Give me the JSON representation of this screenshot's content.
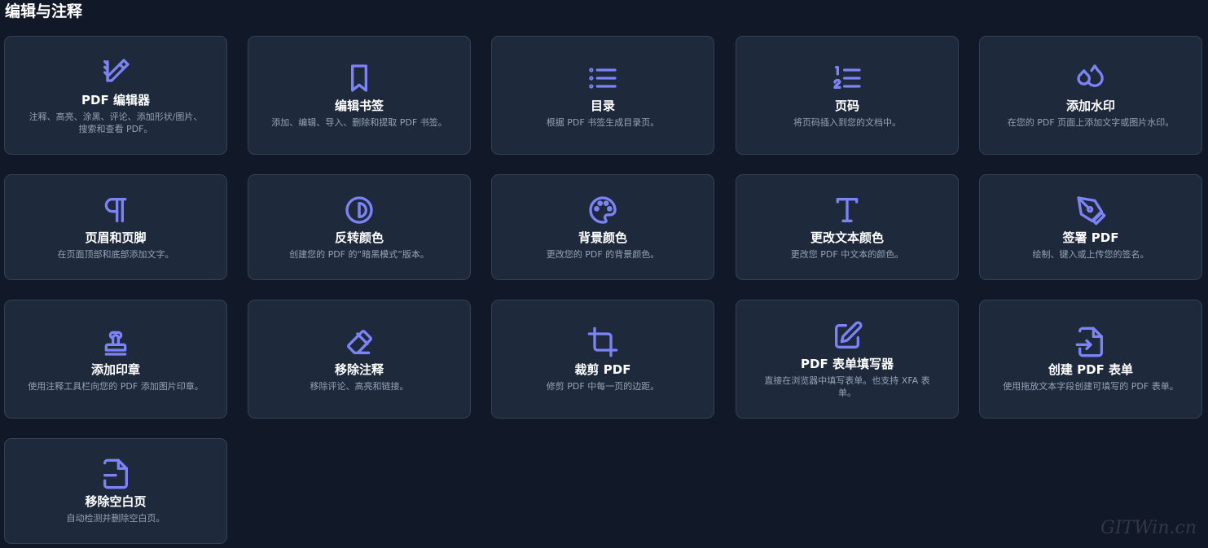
{
  "section": {
    "title": "编辑与注释"
  },
  "cards": [
    {
      "title": "PDF 编辑器",
      "desc": "注释、高亮、涂黑、评论、添加形状/图片、搜索和查看 PDF。",
      "icon": "pen-ruler-icon"
    },
    {
      "title": "编辑书签",
      "desc": "添加、编辑、导入、删除和提取 PDF 书签。",
      "icon": "bookmark-icon"
    },
    {
      "title": "目录",
      "desc": "根据 PDF 书签生成目录页。",
      "icon": "list-icon"
    },
    {
      "title": "页码",
      "desc": "将页码插入到您的文档中。",
      "icon": "numbered-list-icon"
    },
    {
      "title": "添加水印",
      "desc": "在您的 PDF 页面上添加文字或图片水印。",
      "icon": "droplets-icon"
    },
    {
      "title": "页眉和页脚",
      "desc": "在页面顶部和底部添加文字。",
      "icon": "pilcrow-icon"
    },
    {
      "title": "反转颜色",
      "desc": "创建您的 PDF 的“暗黑模式”版本。",
      "icon": "contrast-icon"
    },
    {
      "title": "背景颜色",
      "desc": "更改您的 PDF 的背景颜色。",
      "icon": "palette-icon"
    },
    {
      "title": "更改文本颜色",
      "desc": "更改您 PDF 中文本的颜色。",
      "icon": "type-icon"
    },
    {
      "title": "签署 PDF",
      "desc": "绘制、键入或上传您的签名。",
      "icon": "pen-nib-icon"
    },
    {
      "title": "添加印章",
      "desc": "使用注释工具栏向您的 PDF 添加图片印章。",
      "icon": "stamp-icon"
    },
    {
      "title": "移除注释",
      "desc": "移除评论、高亮和链接。",
      "icon": "eraser-icon"
    },
    {
      "title": "裁剪 PDF",
      "desc": "修剪 PDF 中每一页的边距。",
      "icon": "crop-icon"
    },
    {
      "title": "PDF 表单填写器",
      "desc": "直接在浏览器中填写表单。也支持 XFA 表单。",
      "icon": "edit-square-icon"
    },
    {
      "title": "创建 PDF 表单",
      "desc": "使用拖放文本字段创建可填写的 PDF 表单。",
      "icon": "file-input-icon"
    },
    {
      "title": "移除空白页",
      "desc": "自动检测并删除空白页。",
      "icon": "file-minus-icon"
    }
  ],
  "watermark": "GITWin.cn",
  "colors": {
    "background": "#111827",
    "card": "#1e293b",
    "accent": "#7c83f5",
    "muted": "#94a3b8"
  }
}
